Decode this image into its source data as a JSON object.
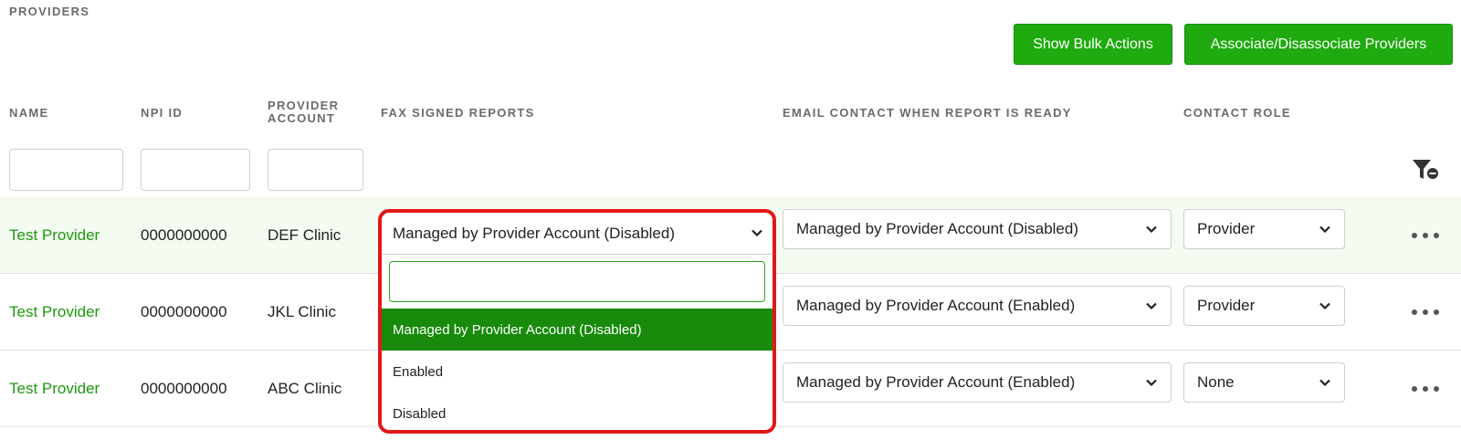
{
  "section": {
    "title": "PROVIDERS"
  },
  "actions": {
    "show_bulk": "Show Bulk Actions",
    "associate": "Associate/Disassociate Providers"
  },
  "columns": {
    "name": "NAME",
    "npi": "NPI ID",
    "provider_account_1": "PROVIDER",
    "provider_account_2": "ACCOUNT",
    "fax": "FAX SIGNED REPORTS",
    "email": "EMAIL CONTACT WHEN REPORT IS READY",
    "role": "CONTACT ROLE"
  },
  "filters": {
    "name": "",
    "npi": "",
    "account": ""
  },
  "rows": [
    {
      "name": "Test Provider",
      "npi": "0000000000",
      "account": "DEF Clinic",
      "email": "Managed by Provider Account (Disabled)",
      "role": "Provider"
    },
    {
      "name": "Test Provider",
      "npi": "0000000000",
      "account": "JKL Clinic",
      "email": "Managed by Provider Account (Enabled)",
      "role": "Provider"
    },
    {
      "name": "Test Provider",
      "npi": "0000000000",
      "account": "ABC Clinic",
      "email": "Managed by Provider Account (Enabled)",
      "role": "None"
    }
  ],
  "fax_dropdown": {
    "selected": "Managed by Provider Account (Disabled)",
    "search_value": "",
    "options": [
      "Managed by Provider Account (Disabled)",
      "Enabled",
      "Disabled"
    ]
  },
  "colors": {
    "accent": "#1faa0f",
    "link": "#1d9a0f",
    "highlight_row": "#f4fbf1",
    "active_option": "#188a0c",
    "callout_border": "#e11818"
  },
  "icons": {
    "filter_clear": "filter-clear-icon",
    "chevron": "chevron-down-icon",
    "more": "more-horizontal-icon"
  }
}
